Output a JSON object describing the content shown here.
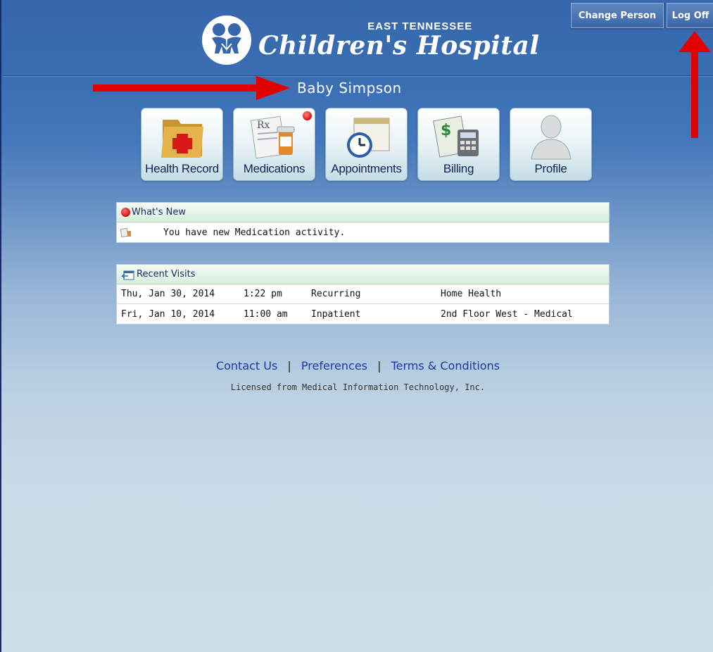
{
  "header": {
    "logo_top": "EAST TENNESSEE",
    "logo_main": "Children's Hospital",
    "change_person_label": "Change Person",
    "log_off_label": "Log Off"
  },
  "patient": {
    "name": "Baby Simpson"
  },
  "nav": {
    "items": [
      {
        "label": "Health Record",
        "icon": "health-record-icon"
      },
      {
        "label": "Medications",
        "icon": "medications-icon",
        "has_notification": true
      },
      {
        "label": "Appointments",
        "icon": "appointments-icon"
      },
      {
        "label": "Billing",
        "icon": "billing-icon"
      },
      {
        "label": "Profile",
        "icon": "profile-icon"
      }
    ]
  },
  "whats_new": {
    "title": "What's New",
    "message": "You have new Medication activity."
  },
  "recent_visits": {
    "title": "Recent Visits",
    "rows": [
      {
        "date": "Thu, Jan 30, 2014",
        "time": "1:22 pm",
        "type": "Recurring",
        "location": "Home Health"
      },
      {
        "date": "Fri, Jan 10, 2014",
        "time": "11:00 am",
        "type": "Inpatient",
        "location": "2nd Floor West - Medical"
      }
    ]
  },
  "footer": {
    "links": [
      "Contact Us",
      "Preferences",
      "Terms & Conditions"
    ],
    "separator": "|",
    "licensed": "Licensed from Medical Information Technology, Inc."
  },
  "colors": {
    "header_blue": "#3667ad",
    "annotation_red": "#e00000",
    "link_blue": "#1a3aa0"
  }
}
